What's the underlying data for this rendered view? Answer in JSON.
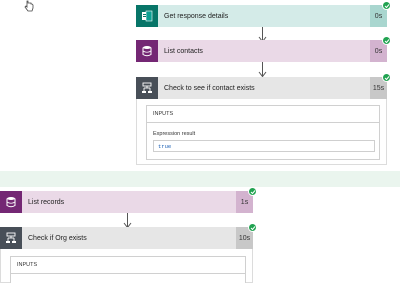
{
  "flow_top": {
    "steps": [
      {
        "label": "Get response details",
        "duration": "0s"
      },
      {
        "label": "List contacts",
        "duration": "0s"
      },
      {
        "label": "Check to see if contact exists",
        "duration": "15s",
        "inputs_title": "INPUTS",
        "expression_label": "Expression result",
        "expression_value": "true"
      }
    ]
  },
  "flow_bottom": {
    "steps": [
      {
        "label": "List records",
        "duration": "1s"
      },
      {
        "label": "Check if Org exists",
        "duration": "10s",
        "inputs_title": "INPUTS"
      }
    ]
  },
  "colors": {
    "forms_header": "#d4ebe8",
    "forms_icon": "#077568",
    "forms_duration": "#a9d6cf",
    "cds_header": "#ead9e7",
    "cds_icon": "#742774",
    "cds_duration": "#d3b3cf",
    "condition_header": "#e6e6e6",
    "condition_icon": "#484f58",
    "condition_duration": "#c8c8c8",
    "success": "#21a351",
    "band": "#eaf5ee"
  },
  "icons": {
    "cursor": "hand-cursor-icon",
    "forms": "forms-icon",
    "database": "database-icon",
    "condition": "condition-icon",
    "success": "checkmark-icon",
    "arrow": "down-arrow-icon"
  }
}
